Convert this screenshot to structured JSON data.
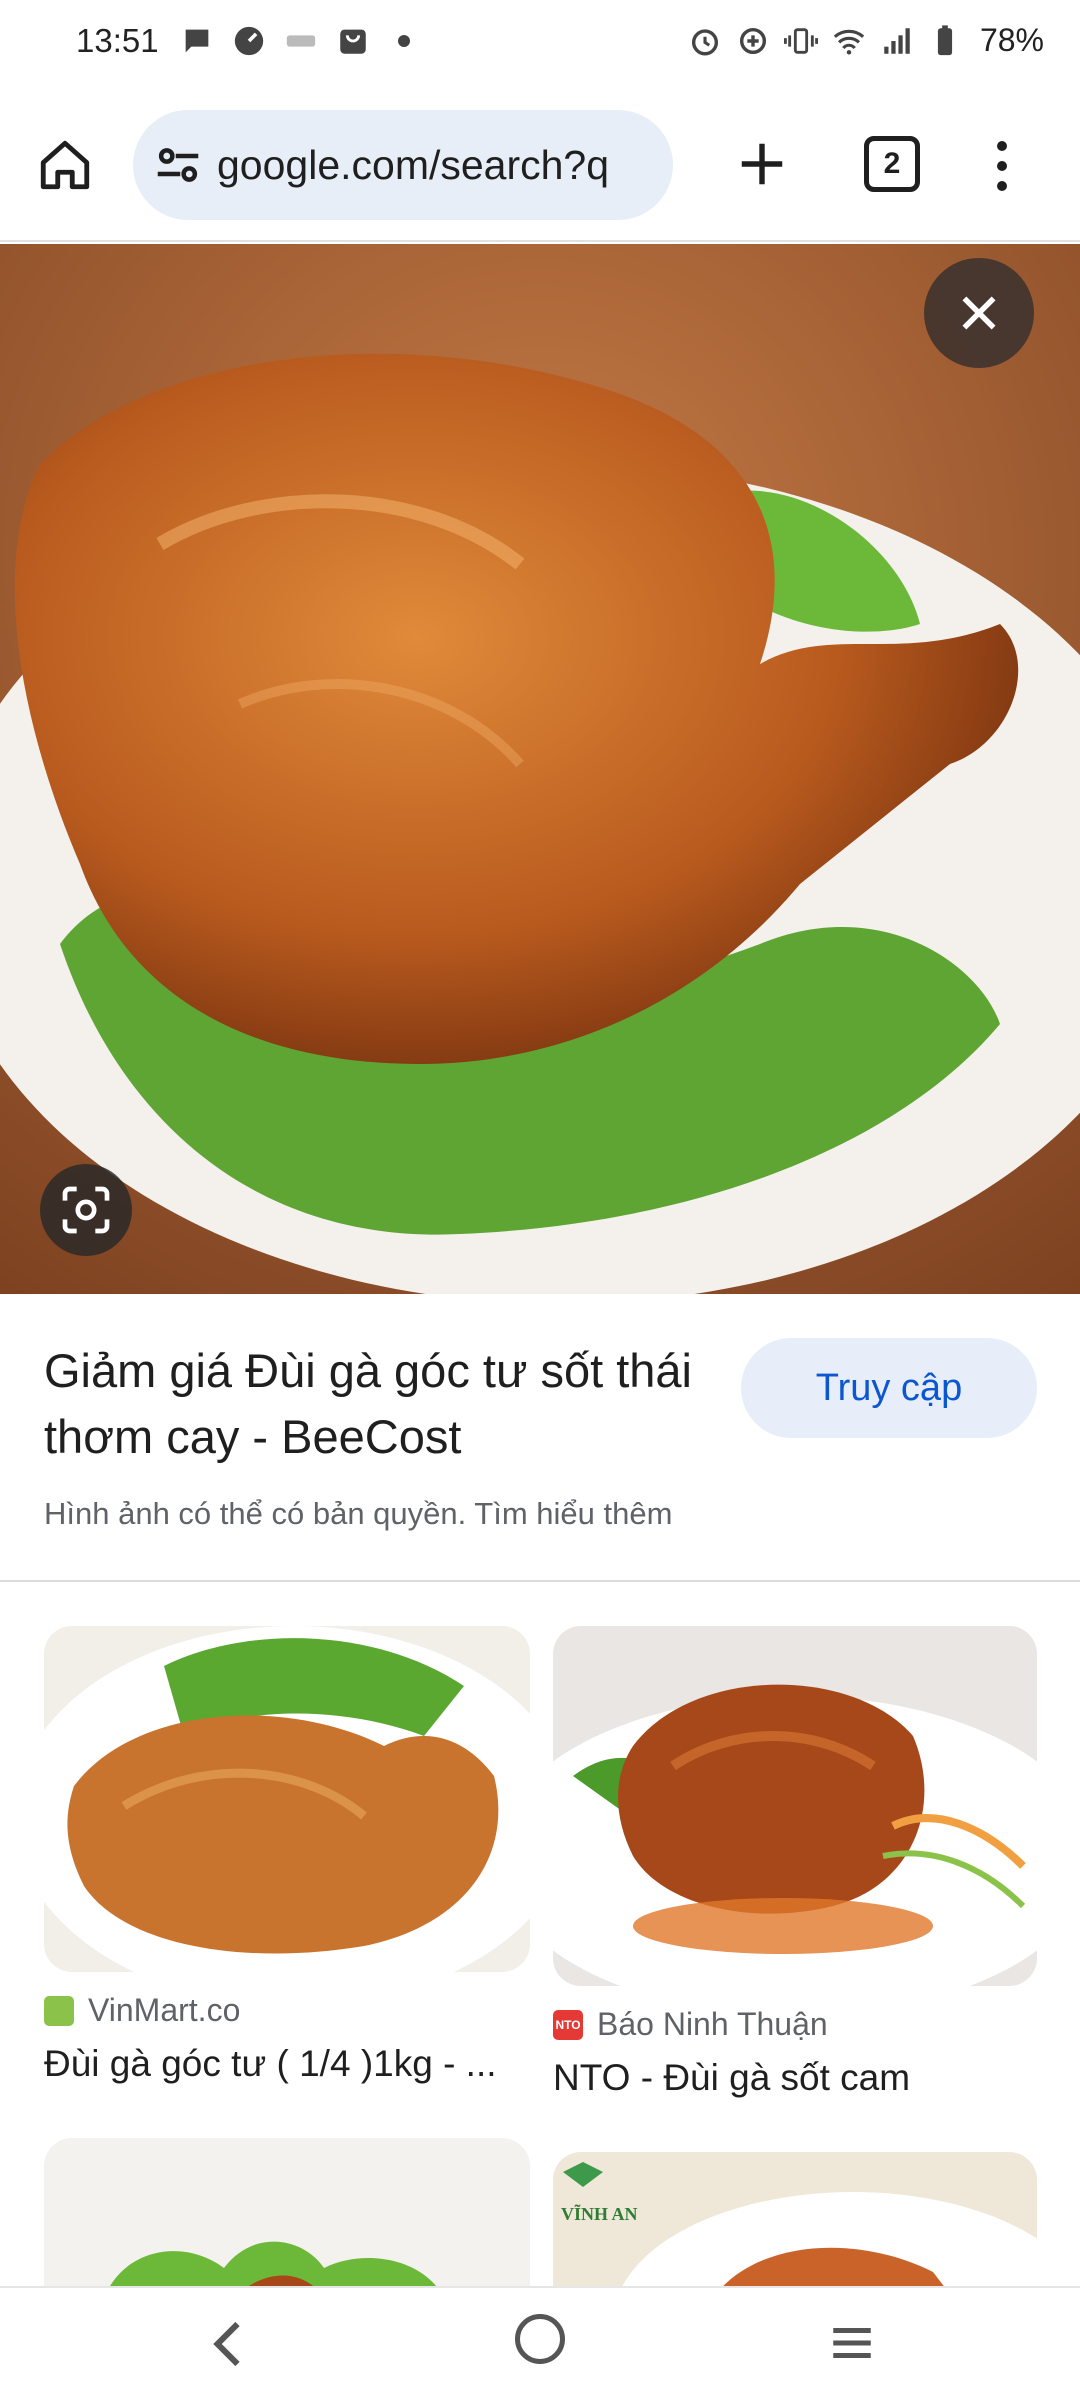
{
  "status_bar": {
    "time": "13:51",
    "battery": "78%",
    "left_icons": [
      "chat-bubble-icon",
      "speedometer-icon",
      "app-notification-icon",
      "shopping-bag-icon",
      "more-dot-icon"
    ],
    "right_icons": [
      "alarm-icon",
      "data-saver-icon",
      "vibrate-icon",
      "wifi-icon",
      "signal-icon",
      "battery-icon"
    ]
  },
  "browser": {
    "url": "google.com/search?q",
    "tab_count": "2"
  },
  "result": {
    "title": "Giảm giá Đùi gà góc tư sốt thái thơm cay - BeeCost",
    "visit_label": "Truy cập",
    "copyright_note": "Hình ảnh có thể có bản quyền. Tìm hiểu thêm"
  },
  "related": [
    {
      "source": "VinMart.co",
      "title": "Đùi gà góc tư ( 1/4 )1kg - ...",
      "favicon_color": "#8bc34a"
    },
    {
      "source": "Báo Ninh Thuận",
      "title": "NTO - Đùi gà sốt cam",
      "favicon_color": "#e53935",
      "favicon_text": "NTO"
    }
  ],
  "partial_row": {
    "right_logo_text": "VĨNH AN"
  },
  "colors": {
    "accent": "#0b57d0",
    "url_bar_bg": "#e8eef7",
    "visit_btn_bg": "#e8eef9"
  }
}
